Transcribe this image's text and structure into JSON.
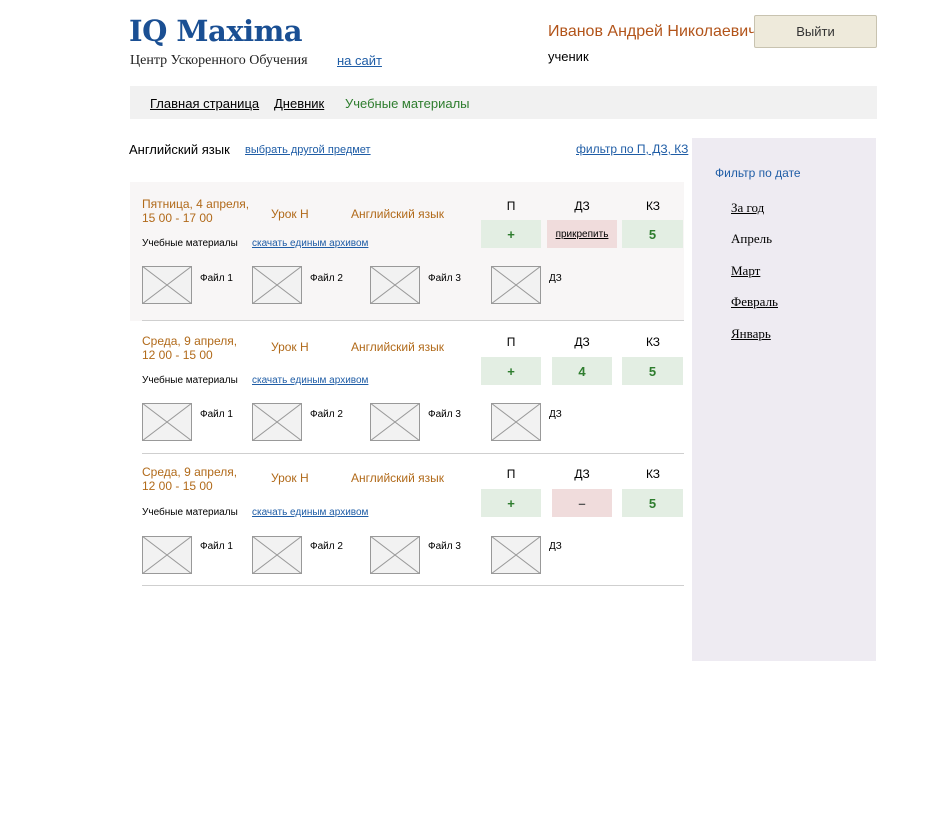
{
  "header": {
    "logo": "IQ Maxima",
    "tagline": "Центр Ускоренного Обучения",
    "to_site_link": "на сайт",
    "user_name": "Иванов Андрей Николаевич",
    "user_role": "ученик",
    "logout_label": "Выйти"
  },
  "nav": {
    "items": [
      "Главная страница",
      "Дневник",
      "Учебные материалы"
    ]
  },
  "subject_bar": {
    "subject": "Английский язык",
    "change_subject_link": "выбрать другой предмет",
    "filter_link": "фильтр по П, ДЗ, КЗ"
  },
  "lessons": [
    {
      "date_line1": "Пятница, 4 апреля,",
      "date_line2": "15 00 - 17 00",
      "lesson_num": "Урок Н",
      "subject": "Английский язык",
      "col_p": "П",
      "col_dz": "ДЗ",
      "col_kz": "КЗ",
      "p_value": "+",
      "dz_value": "прикрепить",
      "kz_value": "5",
      "materials_label": "Учебные материалы",
      "archive_link": "скачать единым архивом",
      "files": [
        "Файл 1",
        "Файл 2",
        "Файл 3",
        "ДЗ"
      ]
    },
    {
      "date_line1": "Среда, 9 апреля,",
      "date_line2": "12 00 - 15 00",
      "lesson_num": "Урок Н",
      "subject": "Английский язык",
      "col_p": "П",
      "col_dz": "ДЗ",
      "col_kz": "КЗ",
      "p_value": "+",
      "dz_value": "4",
      "kz_value": "5",
      "materials_label": "Учебные материалы",
      "archive_link": "скачать единым архивом",
      "files": [
        "Файл 1",
        "Файл 2",
        "Файл 3",
        "ДЗ"
      ]
    },
    {
      "date_line1": "Среда, 9 апреля,",
      "date_line2": "12 00 - 15 00",
      "lesson_num": "Урок Н",
      "subject": "Английский язык",
      "col_p": "П",
      "col_dz": "ДЗ",
      "col_kz": "КЗ",
      "p_value": "+",
      "dz_value": "–",
      "kz_value": "5",
      "materials_label": "Учебные материалы",
      "archive_link": "скачать единым архивом",
      "files": [
        "Файл 1",
        "Файл 2",
        "Файл 3",
        "ДЗ"
      ]
    }
  ],
  "sidebar": {
    "title": "Фильтр по дате",
    "items": [
      "За год",
      "Апрель",
      "Март",
      "Февраль",
      "Январь"
    ]
  },
  "colors": {
    "brand_blue": "#1a4f93",
    "link_blue": "#1f5da6",
    "accent_orange": "#b16a1a",
    "active_green": "#2e7d2e",
    "green_cell": "#e3eee3",
    "red_cell": "#f0dcdc",
    "sidebar_bg": "#eeebf2"
  },
  "icons": {
    "file_thumbnail": "image-placeholder-icon"
  }
}
